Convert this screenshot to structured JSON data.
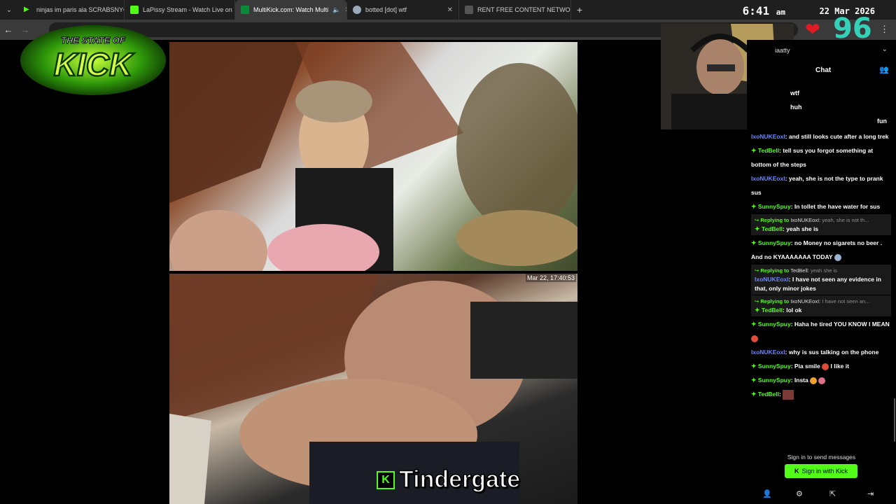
{
  "tabs": [
    {
      "title": "ninjas im paris ala SCRABSNYC",
      "icon_color": "#53fc18",
      "active": false
    },
    {
      "title": "LaPissy Stream - Watch Live on",
      "icon_color": "#53fc18",
      "active": false
    },
    {
      "title": "MultiKick.com: Watch Multi",
      "icon_color": "#0b8a3a",
      "active": true
    },
    {
      "title": "botted [dot] wtf",
      "icon_color": "#9ab",
      "active": false
    },
    {
      "title": "RENT FREE CONTENT NETWOR",
      "icon_color": "#555",
      "active": false
    }
  ],
  "clock": {
    "time": "6:41",
    "ampm": "am",
    "date": "22 Mar 2026"
  },
  "overlay": {
    "logo_line1": "THE STATE OF",
    "logo_line2": "KICK",
    "viewer_count": "96",
    "heart_icon": "heart-icon"
  },
  "video": {
    "timestamp": "Mar 22, 17:40:53",
    "caption": "Tindergate",
    "caption_logo": "K"
  },
  "chat": {
    "username_partial": "iaatty",
    "title": "Chat",
    "stub_lines": [
      "wtf",
      "huh",
      "fun"
    ],
    "messages": [
      {
        "user": "IxoNUKEoxI",
        "color": "blue",
        "badge": false,
        "text": "and still looks cute after a long trek"
      },
      {
        "user": "TedBell",
        "color": "green",
        "badge": true,
        "text": "tell sus you forgot something at bottom of the steps"
      },
      {
        "user": "IxoNUKEoxI",
        "color": "blue",
        "badge": false,
        "text": "yeah, she is not the type to prank sus"
      },
      {
        "user": "SunnySpuy",
        "color": "green",
        "badge": true,
        "text": "In tollet the have water for sus"
      }
    ],
    "reply1": {
      "label": "Replying to",
      "to": "IxoNUKEoxI:",
      "preview": "yeah, she is not th...",
      "user": "TedBell",
      "text": "yeah she is"
    },
    "msg_after_reply1": {
      "user": "SunnySpuy",
      "text": "no Money no sigarets no beer . And no KYAAAAAAA TODAY"
    },
    "reply2": {
      "label": "Replying to",
      "to": "TedBell:",
      "preview": "yeah she is",
      "user": "IxoNUKEoxI",
      "text": "I have not seen any evidence in that, only minor jokes"
    },
    "reply3": {
      "label": "Replying to",
      "to": "IxoNUKEoxI:",
      "preview": "I have not seen an...",
      "user": "TedBell",
      "text": "lol ok"
    },
    "messages2": [
      {
        "user": "SunnySpuy",
        "color": "green",
        "badge": true,
        "text": "Haha he tired YOU KNOW I MEAN"
      },
      {
        "user": "IxoNUKEoxI",
        "color": "blue",
        "badge": false,
        "text": "why is sus talking on the phone"
      },
      {
        "user": "SunnySpuy",
        "color": "green",
        "badge": true,
        "text": "Pia smile"
      },
      {
        "user": "SunnySpuy",
        "color": "green",
        "badge": true,
        "text": "Insta"
      }
    ],
    "pia_tail": "I like it",
    "last_user": "TedBell",
    "signin_prompt": "Sign in to send messages",
    "signin_button": "Sign in with Kick",
    "signin_logo": "K"
  },
  "colors": {
    "kick_green": "#53fc18",
    "username_blue": "#6b86ff",
    "viewer_teal": "#35d0b8"
  }
}
